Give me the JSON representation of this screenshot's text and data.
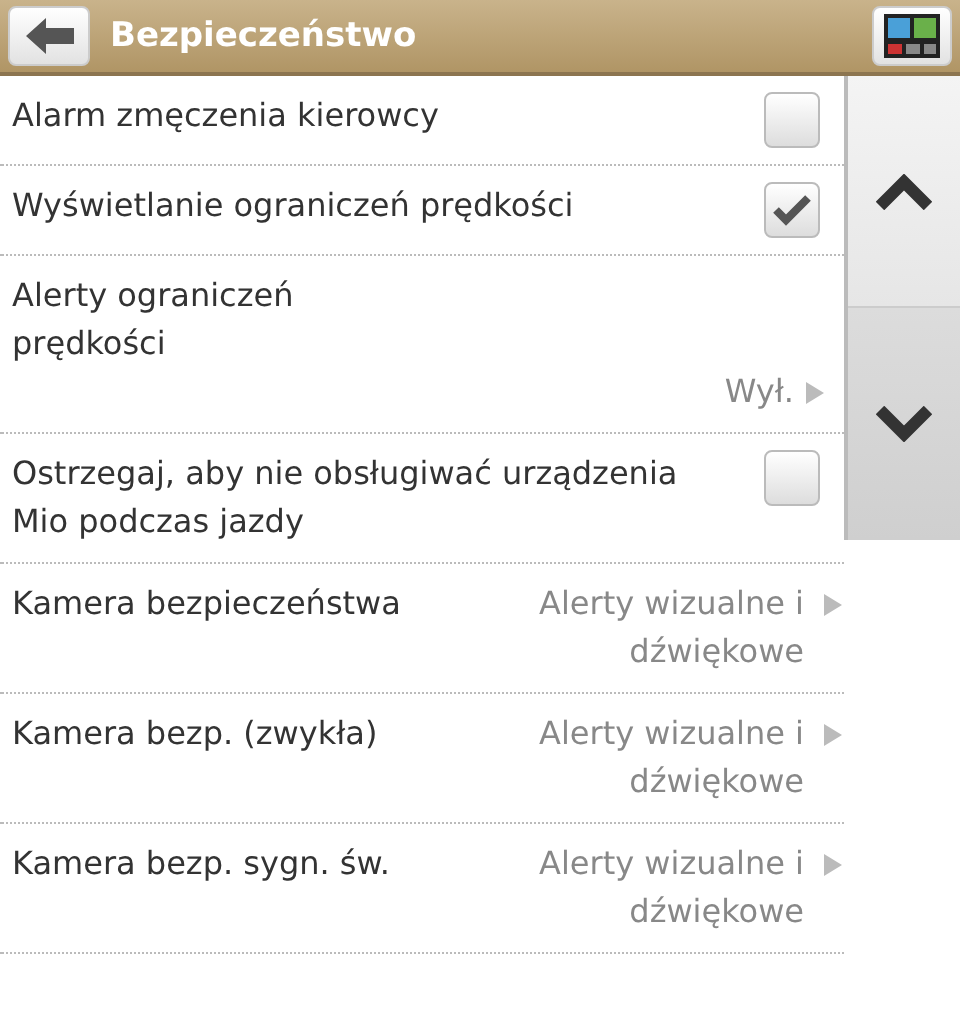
{
  "header": {
    "title": "Bezpieczeństwo"
  },
  "items": [
    {
      "kind": "checkbox",
      "label": "Alarm zmęczenia kierowcy",
      "checked": false
    },
    {
      "kind": "checkbox",
      "label": "Wyświetlanie ograniczeń prędkości",
      "checked": true
    },
    {
      "kind": "stacked",
      "label": "Alerty ograniczeń prędkości",
      "value": "Wył."
    },
    {
      "kind": "checkbox",
      "label": "Ostrzegaj, aby nie obsługiwać urządzenia Mio podczas jazdy",
      "checked": false
    },
    {
      "kind": "value",
      "label": "Kamera bezpieczeństwa",
      "value": "Alerty wizualne i dźwiękowe"
    },
    {
      "kind": "value",
      "label": "Kamera bezp. (zwykła)",
      "value": "Alerty wizualne i dźwiękowe"
    },
    {
      "kind": "value",
      "label": "Kamera bezp. sygn. św.",
      "value": "Alerty wizualne i dźwiękowe"
    }
  ]
}
